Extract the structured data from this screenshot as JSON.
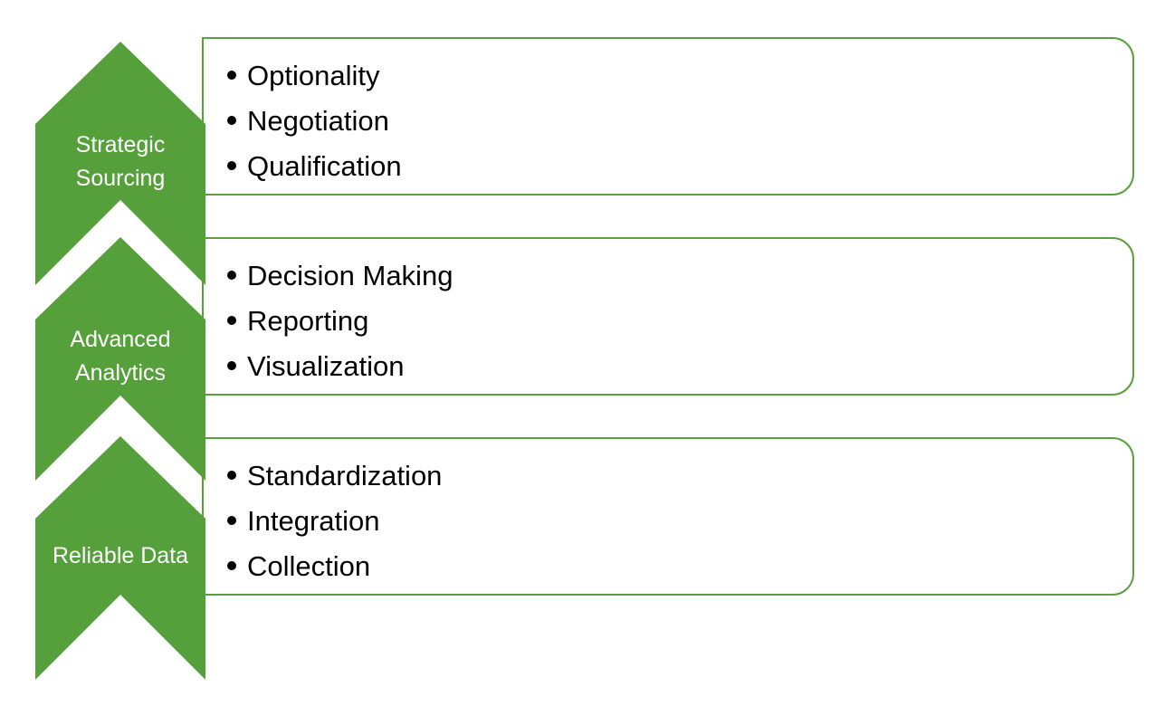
{
  "colors": {
    "chevron_fill": "#55a03a",
    "box_border": "#5b9f3f",
    "label_text": "#ffffff"
  },
  "levels": [
    {
      "label": [
        "Strategic",
        "Sourcing"
      ],
      "items": [
        "Optionality",
        "Negotiation",
        "Qualification"
      ]
    },
    {
      "label": [
        "Advanced",
        "Analytics"
      ],
      "items": [
        "Decision Making",
        "Reporting",
        "Visualization"
      ]
    },
    {
      "label": [
        "Reliable Data"
      ],
      "items": [
        "Standardization",
        "Integration",
        "Collection"
      ]
    }
  ]
}
